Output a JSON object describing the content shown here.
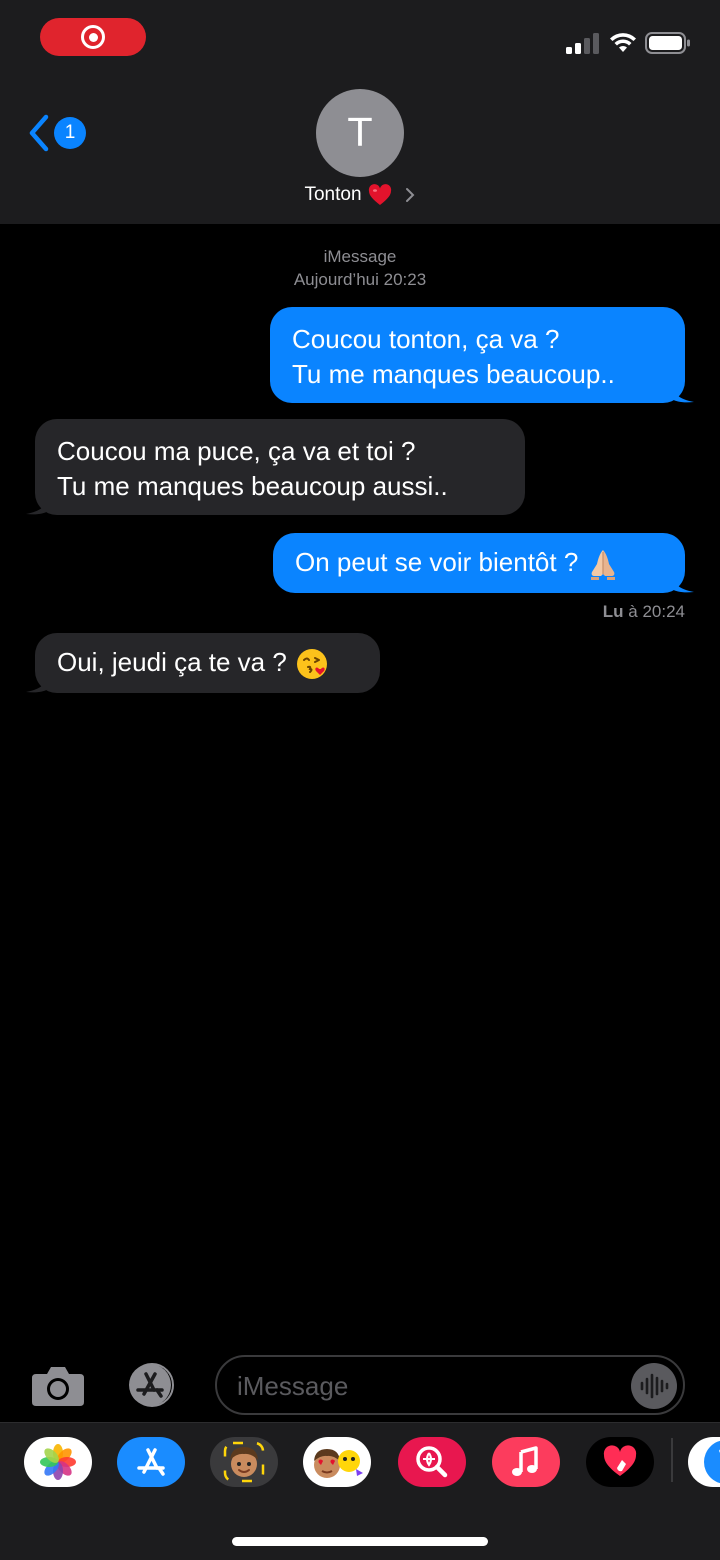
{
  "status_bar": {
    "recording": "screen-record-indicator",
    "signal_icon": "cellular-signal-icon",
    "wifi_icon": "wifi-icon",
    "battery_icon": "battery-icon"
  },
  "header": {
    "back_badge": "1",
    "avatar_initial": "T",
    "contact_name": "Tonton",
    "contact_emoji": "red-heart"
  },
  "conversation": {
    "service": "iMessage",
    "timestamp": "Aujourd’hui 20:23",
    "messages": [
      {
        "direction": "outgoing",
        "lines": [
          "Coucou tonton, ça va ?",
          "Tu me manques beaucoup.."
        ]
      },
      {
        "direction": "incoming",
        "lines": [
          "Coucou ma puce, ça va et toi ?",
          "Tu me manques beaucoup aussi.."
        ]
      },
      {
        "direction": "outgoing",
        "lines": [
          "On peut se voir bientôt ?"
        ],
        "emoji": "folded-hands"
      },
      {
        "direction": "incoming",
        "lines": [
          "Oui, jeudi ça te va ?"
        ],
        "emoji": "face-blowing-kiss"
      }
    ],
    "read_receipt_label": "Lu",
    "read_receipt_time": "à 20:24"
  },
  "composer": {
    "placeholder": "iMessage",
    "camera_icon": "camera-icon",
    "apps_icon": "app-store-icon",
    "audio_icon": "audio-waveform-icon"
  },
  "app_drawer": {
    "apps": [
      "photos",
      "app-store",
      "memoji",
      "animoji-stickers",
      "images-search",
      "music",
      "digital-touch",
      "app-store-partial"
    ]
  },
  "colors": {
    "accent": "#0a84ff",
    "incoming_bubble": "#262629",
    "header_bg": "#1c1c1e",
    "recording": "#e0242d"
  }
}
